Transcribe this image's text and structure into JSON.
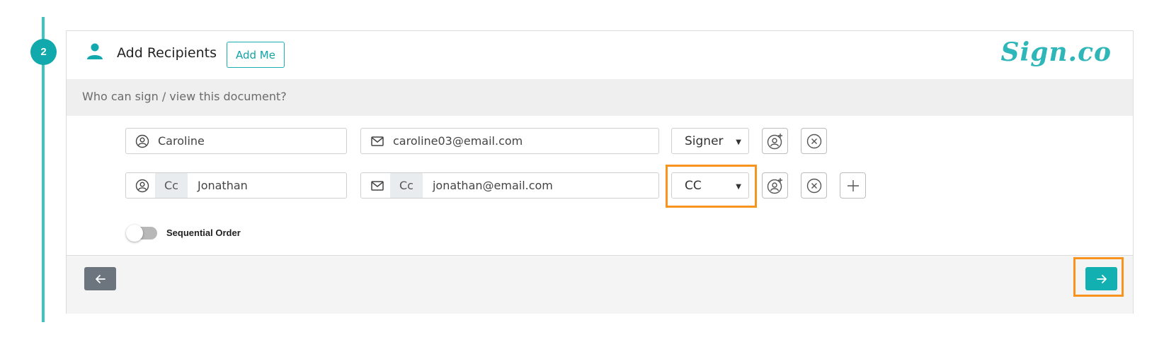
{
  "step": {
    "number": "2"
  },
  "header": {
    "title": "Add Recipients",
    "add_me_label": "Add Me",
    "brand": "Sign.co",
    "icon": "person-icon"
  },
  "subheader": {
    "text": "Who can sign / view this document?"
  },
  "recipients": [
    {
      "name": "Caroline",
      "email": "caroline03@email.com",
      "cc_tag": "",
      "role": "Signer"
    },
    {
      "name": "Jonathan",
      "email": "jonathan@email.com",
      "cc_tag": "Cc",
      "role": "CC"
    }
  ],
  "sequential_order": {
    "label": "Sequential Order",
    "enabled": false
  },
  "colors": {
    "accent": "#12a9ad",
    "highlight": "#f7941d",
    "back_button": "#6c757d"
  }
}
